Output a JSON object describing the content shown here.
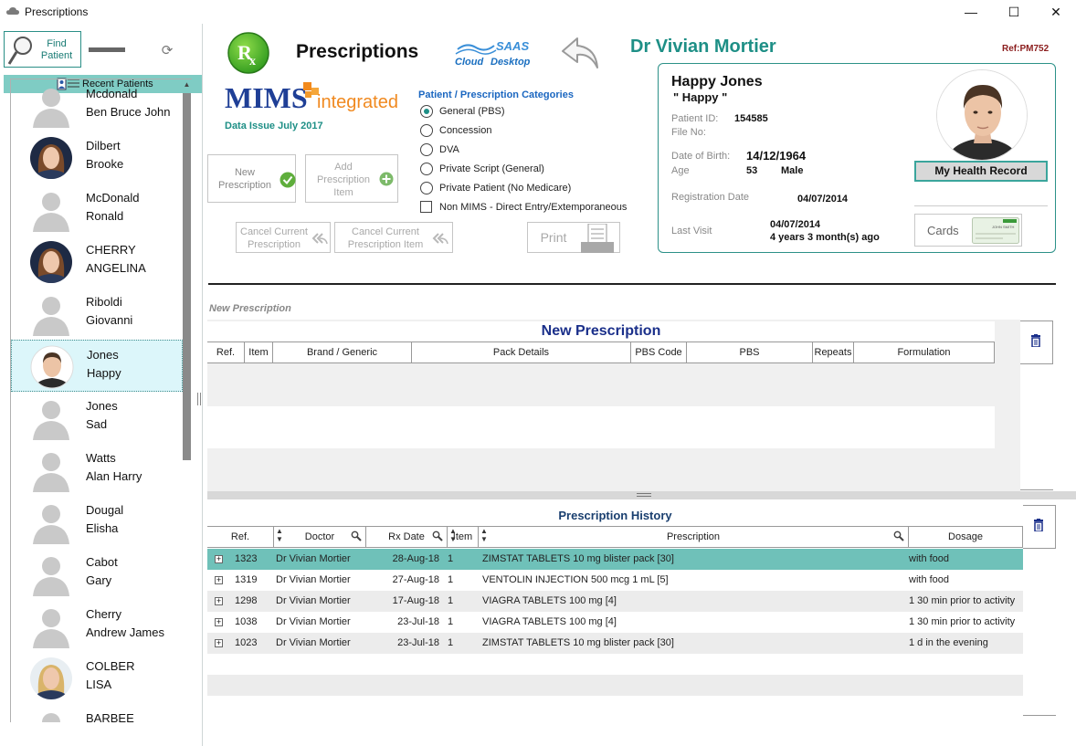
{
  "window": {
    "title": "Prescriptions",
    "minimize": "—",
    "maximize": "☐",
    "close": "✕"
  },
  "left": {
    "find_label_1": "Find",
    "find_label_2": "Patient",
    "recent_label": "Recent Patients",
    "patients": [
      {
        "line1": "Mcdonald",
        "line2": "Ben Bruce John",
        "photo": "silhouette"
      },
      {
        "line1": "Dilbert",
        "line2": "Brooke",
        "photo": "woman-brown"
      },
      {
        "line1": "McDonald",
        "line2": "Ronald",
        "photo": "silhouette"
      },
      {
        "line1": "CHERRY",
        "line2": "ANGELINA",
        "photo": "woman-brown"
      },
      {
        "line1": "Riboldi",
        "line2": "Giovanni",
        "photo": "silhouette"
      },
      {
        "line1": "Jones",
        "line2": "Happy",
        "photo": "man-photo",
        "selected": true
      },
      {
        "line1": "Jones",
        "line2": "Sad",
        "photo": "silhouette"
      },
      {
        "line1": "Watts",
        "line2": "Alan Harry",
        "photo": "silhouette"
      },
      {
        "line1": "Dougal",
        "line2": "Elisha",
        "photo": "silhouette"
      },
      {
        "line1": "Cabot",
        "line2": "Gary",
        "photo": "silhouette"
      },
      {
        "line1": "Cherry",
        "line2": "Andrew James",
        "photo": "silhouette"
      },
      {
        "line1": "COLBER",
        "line2": "LISA",
        "photo": "woman-blonde"
      },
      {
        "line1": "BARBEE",
        "line2": "",
        "photo": "silhouette"
      }
    ]
  },
  "header": {
    "title": "Prescriptions",
    "saas_top": "SAAS",
    "saas_bottom_1": "Cloud",
    "saas_bottom_2": "Desktop",
    "doctor": "Dr Vivian Mortier",
    "ref": "Ref:PM752",
    "mims_1": "MIMS",
    "mims_2": "integrated",
    "data_issue": "Data Issue   July 2017"
  },
  "actions": {
    "new_prescription": "New Prescription",
    "add_item": "Add Prescription Item",
    "cancel_current": "Cancel Current Prescription",
    "cancel_item": "Cancel Current Prescription Item",
    "print": "Print"
  },
  "categories": {
    "title": "Patient / Prescription Categories",
    "options": [
      {
        "label": "General (PBS)",
        "checked": true
      },
      {
        "label": "Concession",
        "checked": false
      },
      {
        "label": "DVA",
        "checked": false
      },
      {
        "label": "Private Script (General)",
        "checked": false
      },
      {
        "label": "Private Patient (No Medicare)",
        "checked": false
      }
    ],
    "non_mims": "Non MIMS - Direct Entry/Extemporaneous"
  },
  "patient": {
    "name": "Happy Jones",
    "nickname": "\" Happy \"",
    "id_label": "Patient ID:",
    "id": "154585",
    "file_label": "File No:",
    "dob_label": "Date of Birth:",
    "dob": "14/12/1964",
    "age_label": "Age",
    "age": "53",
    "sex": "Male",
    "reg_label": "Registration Date",
    "reg_date": "04/07/2014",
    "last_visit_label": "Last Visit",
    "last_visit": "04/07/2014",
    "last_visit_ago": "4 years 3 month(s) ago",
    "mhr_label": "My Health Record",
    "cards_label": "Cards",
    "card_mini_text": "JOHN SMITH"
  },
  "new_prescription": {
    "caption": "New Prescription",
    "title": "New Prescription",
    "columns": [
      "Ref.",
      "Item",
      "Brand / Generic",
      "Pack Details",
      "PBS Code",
      "PBS",
      "Repeats",
      "Formulation"
    ]
  },
  "history": {
    "title": "Prescription History",
    "columns": [
      "Ref.",
      "Doctor",
      "Rx Date",
      "Item",
      "Prescription",
      "Dosage"
    ],
    "rows": [
      {
        "ref": "1323",
        "doctor": "Dr Vivian Mortier",
        "date": "28-Aug-18",
        "item": "1",
        "prescription": "ZIMSTAT TABLETS 10 mg blister pack [30]",
        "dosage": "with food",
        "selected": true
      },
      {
        "ref": "1319",
        "doctor": "Dr Vivian Mortier",
        "date": "27-Aug-18",
        "item": "1",
        "prescription": "VENTOLIN INJECTION 500 mcg 1 mL [5]",
        "dosage": "with food"
      },
      {
        "ref": "1298",
        "doctor": "Dr Vivian Mortier",
        "date": "17-Aug-18",
        "item": "1",
        "prescription": "VIAGRA TABLETS 100 mg [4]",
        "dosage": "1 30 min prior to activity"
      },
      {
        "ref": "1038",
        "doctor": "Dr Vivian Mortier",
        "date": "23-Jul-18",
        "item": "1",
        "prescription": "VIAGRA TABLETS 100 mg [4]",
        "dosage": "1 30 min prior to activity"
      },
      {
        "ref": "1023",
        "doctor": "Dr Vivian Mortier",
        "date": "23-Jul-18",
        "item": "1",
        "prescription": "ZIMSTAT TABLETS 10 mg blister pack [30]",
        "dosage": "1 d in the evening"
      }
    ]
  },
  "colors": {
    "accent": "#1e8f86",
    "selected_row": "#6fc1b9",
    "recent_bar": "#7fccc4",
    "title_blue": "#1a2f8a"
  }
}
